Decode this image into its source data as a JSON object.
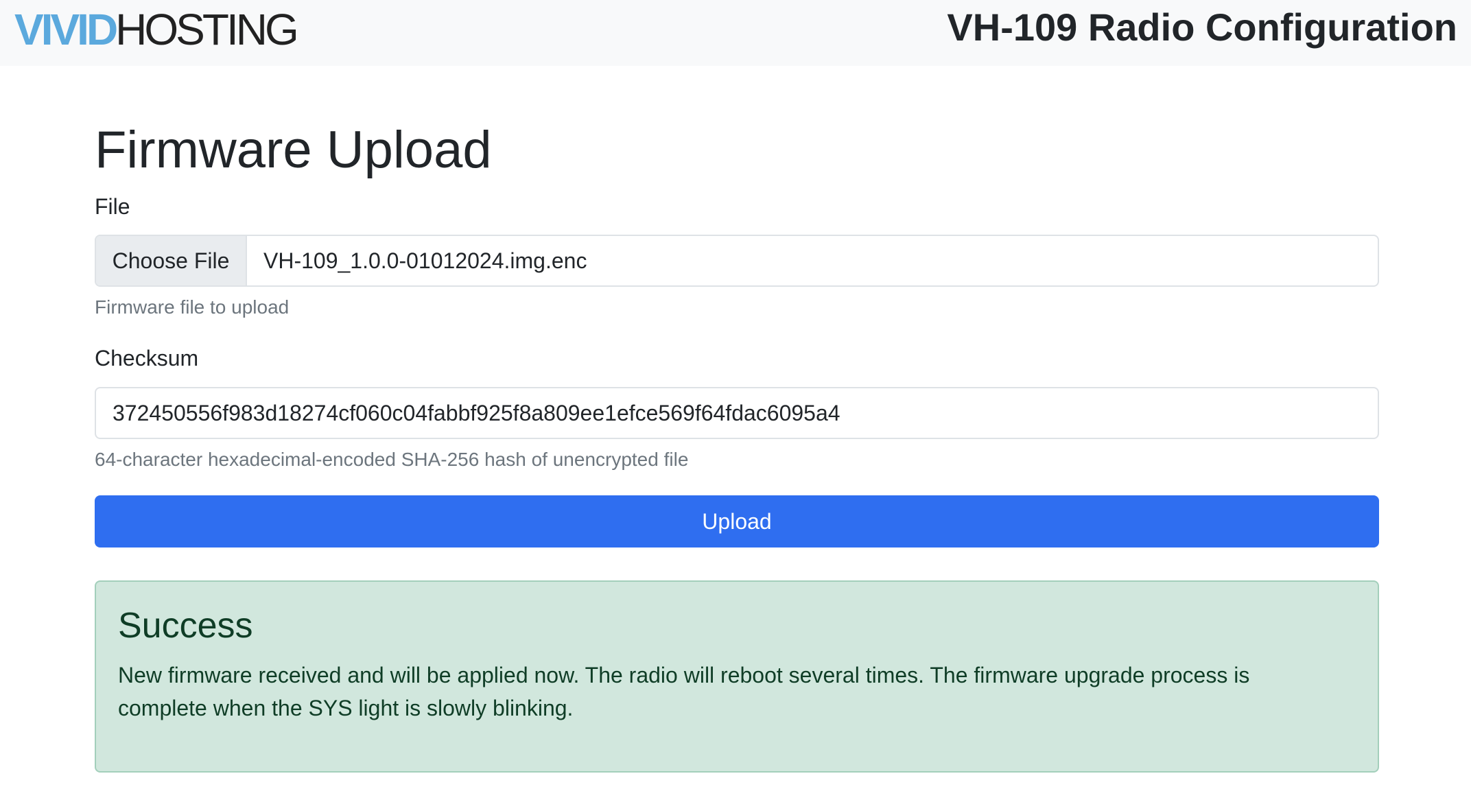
{
  "header": {
    "brand_vivid": "VIVID",
    "brand_hosting": "HOSTING",
    "title": "VH-109 Radio Configuration"
  },
  "form": {
    "page_title": "Firmware Upload",
    "file_label": "File",
    "file_button": "Choose File",
    "file_name": "VH-109_1.0.0-01012024.img.enc",
    "file_help": "Firmware file to upload",
    "checksum_label": "Checksum",
    "checksum_value": "372450556f983d18274cf060c04fabbf925f8a809ee1efce569f64fdac6095a4",
    "checksum_help": "64-character hexadecimal-encoded SHA-256 hash of unencrypted file",
    "upload_button": "Upload"
  },
  "alert": {
    "heading": "Success",
    "message": "New firmware received and will be applied now. The radio will reboot several times. The firmware upgrade process is complete when the SYS light is slowly blinking."
  },
  "colors": {
    "brand_accent": "#5ba9dd",
    "primary_button": "#2f6ef0",
    "success_bg": "#d1e7dd",
    "success_text": "#0f3d26"
  }
}
